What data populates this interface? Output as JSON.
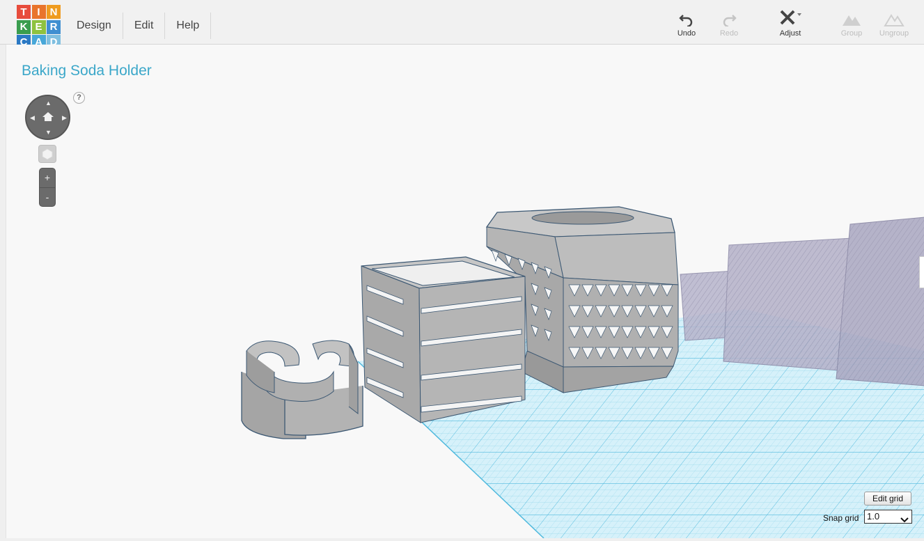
{
  "logo": {
    "letters": [
      "T",
      "I",
      "N",
      "K",
      "E",
      "R",
      "C",
      "A",
      "D"
    ],
    "colors": [
      "#e74c3c",
      "#e9742b",
      "#ef9b1f",
      "#3a9d4e",
      "#8ec23f",
      "#3f8fd1",
      "#2b79c4",
      "#48a7d8",
      "#7fbfe0"
    ]
  },
  "menu": {
    "design": "Design",
    "edit": "Edit",
    "help": "Help"
  },
  "toolbar": {
    "undo": "Undo",
    "redo": "Redo",
    "adjust": "Adjust",
    "group": "Group",
    "ungroup": "Ungroup"
  },
  "design_title": "Baking Soda Holder",
  "navigation": {
    "help": "?",
    "zoom_in": "+",
    "zoom_out": "-"
  },
  "grid_controls": {
    "edit_grid": "Edit grid",
    "snap_grid_label": "Snap grid",
    "snap_grid_value": "1.0"
  },
  "colors": {
    "accent": "#3ba7c9",
    "grid": "#6cc6e3",
    "grid_fill": "#cdeef8",
    "model": "#a4a4a4",
    "model_edge": "#3c5873",
    "ghost": "#9a97b3"
  }
}
